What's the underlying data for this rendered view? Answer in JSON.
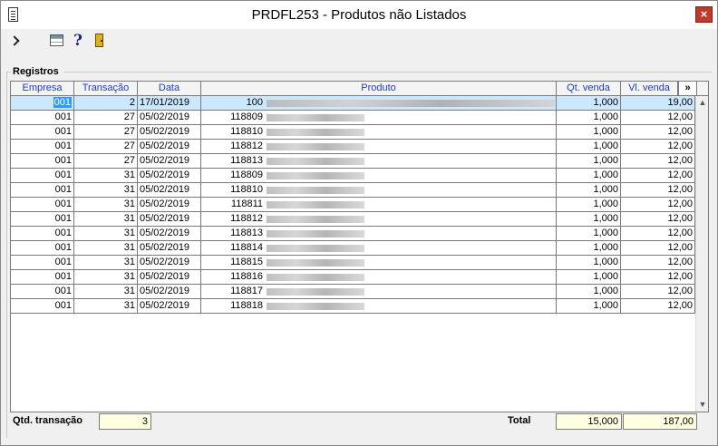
{
  "window": {
    "title": "PRDFL253 - Produtos não Listados",
    "close_glyph": "×"
  },
  "toolbar": {
    "items": [
      "exit-icon",
      "table-grid-icon",
      "help-icon",
      "door-icon"
    ],
    "help_glyph": "?"
  },
  "section": {
    "label": "Registros"
  },
  "table": {
    "columns": [
      "Empresa",
      "Transação",
      "Data",
      "Produto",
      "Qt. venda",
      "Vl. venda"
    ],
    "more_label": "»",
    "rows": [
      {
        "empresa": "001",
        "transacao": "2",
        "data": "17/01/2019",
        "produto": "100",
        "qt": "1,000",
        "vl": "19,00"
      },
      {
        "empresa": "001",
        "transacao": "27",
        "data": "05/02/2019",
        "produto": "118809",
        "qt": "1,000",
        "vl": "12,00"
      },
      {
        "empresa": "001",
        "transacao": "27",
        "data": "05/02/2019",
        "produto": "118810",
        "qt": "1,000",
        "vl": "12,00"
      },
      {
        "empresa": "001",
        "transacao": "27",
        "data": "05/02/2019",
        "produto": "118812",
        "qt": "1,000",
        "vl": "12,00"
      },
      {
        "empresa": "001",
        "transacao": "27",
        "data": "05/02/2019",
        "produto": "118813",
        "qt": "1,000",
        "vl": "12,00"
      },
      {
        "empresa": "001",
        "transacao": "31",
        "data": "05/02/2019",
        "produto": "118809",
        "qt": "1,000",
        "vl": "12,00"
      },
      {
        "empresa": "001",
        "transacao": "31",
        "data": "05/02/2019",
        "produto": "118810",
        "qt": "1,000",
        "vl": "12,00"
      },
      {
        "empresa": "001",
        "transacao": "31",
        "data": "05/02/2019",
        "produto": "118811",
        "qt": "1,000",
        "vl": "12,00"
      },
      {
        "empresa": "001",
        "transacao": "31",
        "data": "05/02/2019",
        "produto": "118812",
        "qt": "1,000",
        "vl": "12,00"
      },
      {
        "empresa": "001",
        "transacao": "31",
        "data": "05/02/2019",
        "produto": "118813",
        "qt": "1,000",
        "vl": "12,00"
      },
      {
        "empresa": "001",
        "transacao": "31",
        "data": "05/02/2019",
        "produto": "118814",
        "qt": "1,000",
        "vl": "12,00"
      },
      {
        "empresa": "001",
        "transacao": "31",
        "data": "05/02/2019",
        "produto": "118815",
        "qt": "1,000",
        "vl": "12,00"
      },
      {
        "empresa": "001",
        "transacao": "31",
        "data": "05/02/2019",
        "produto": "118816",
        "qt": "1,000",
        "vl": "12,00"
      },
      {
        "empresa": "001",
        "transacao": "31",
        "data": "05/02/2019",
        "produto": "118817",
        "qt": "1,000",
        "vl": "12,00"
      },
      {
        "empresa": "001",
        "transacao": "31",
        "data": "05/02/2019",
        "produto": "118818",
        "qt": "1,000",
        "vl": "12,00"
      }
    ],
    "selected_row": 0
  },
  "footer": {
    "qtd_label": "Qtd. transação",
    "qtd_value": "3",
    "total_label": "Total",
    "total_qt": "15,000",
    "total_vl": "187,00"
  },
  "colors": {
    "header_text": "#1a3cc8",
    "selected_row": "#cce8ff",
    "field_bg": "#ffffe1",
    "close_button": "#c0392b"
  }
}
